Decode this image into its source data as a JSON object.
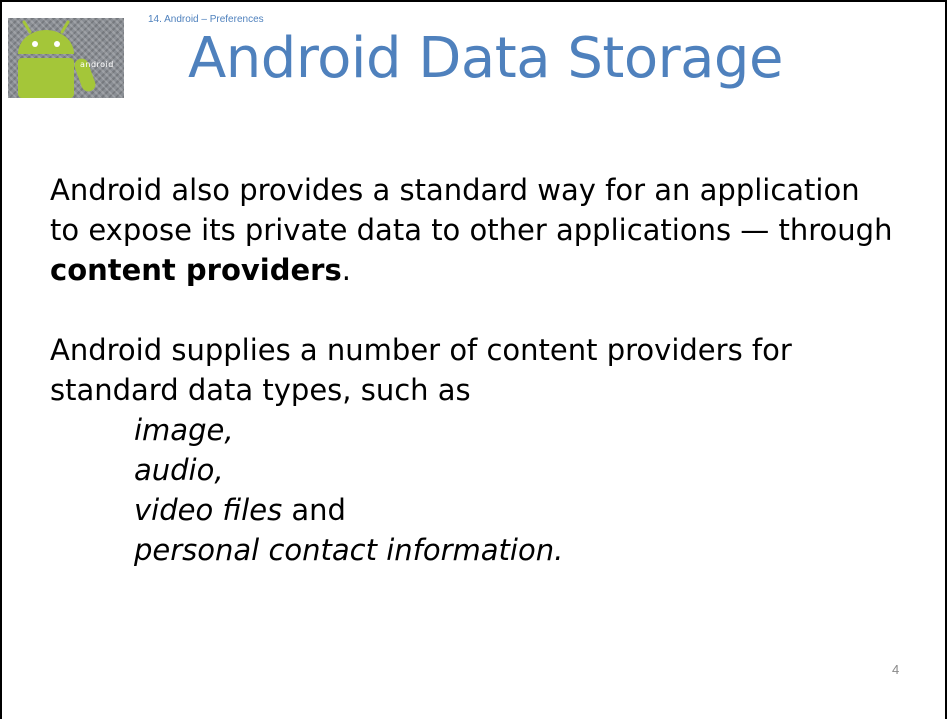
{
  "header": {
    "subtitle": "14. Android – Preferences",
    "title": "Android Data Storage",
    "logo_text": "android"
  },
  "content": {
    "paragraph1": {
      "line1": "Android also provides a standard way for an application",
      "line2": "to expose its private data to other applications — through",
      "bold": "content providers",
      "end": "."
    },
    "paragraph2": {
      "line1": "Android supplies a number of content providers for",
      "line2": "standard data types, such as"
    },
    "list": {
      "item1": "image,",
      "item2": "audio,",
      "item3_italic": "video files",
      "item3_rest": " and",
      "item4": "personal contact information."
    }
  },
  "footer": {
    "page_number": "4"
  },
  "colors": {
    "title": "#4f81bd",
    "android_green": "#a4c639"
  }
}
